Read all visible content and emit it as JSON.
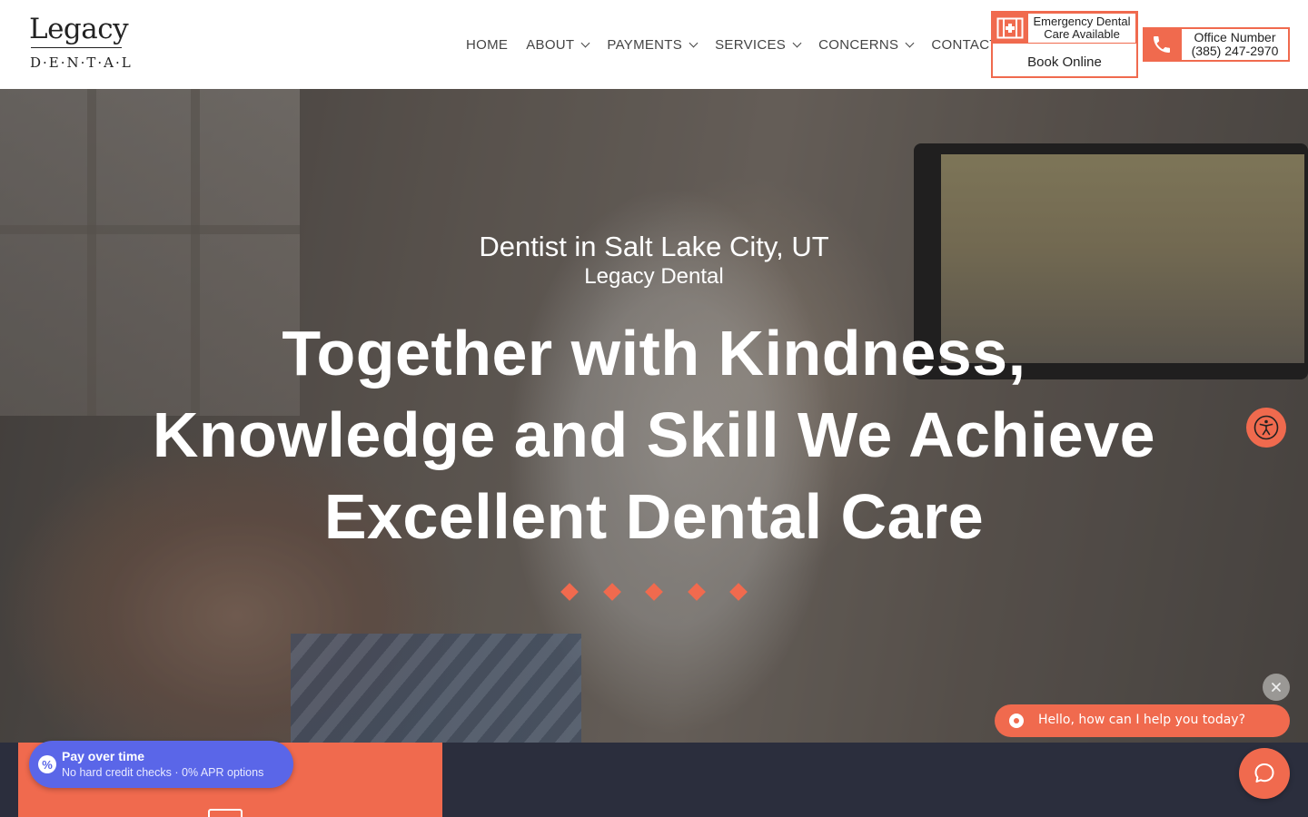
{
  "brand": {
    "logo_top": "Legacy",
    "logo_bottom": "D·E·N·T·A·L"
  },
  "nav": {
    "items": [
      {
        "label": "HOME",
        "dropdown": false
      },
      {
        "label": "ABOUT",
        "dropdown": true
      },
      {
        "label": "PAYMENTS",
        "dropdown": true
      },
      {
        "label": "SERVICES",
        "dropdown": true
      },
      {
        "label": "CONCERNS",
        "dropdown": true
      },
      {
        "label": "CONTACT",
        "dropdown": false
      }
    ]
  },
  "emergency": {
    "line1": "Emergency Dental",
    "line2": "Care Available",
    "icon": "medical-cross-icon"
  },
  "book_online": "Book Online",
  "office": {
    "label": "Office Number",
    "phone": "(385) 247-2970",
    "icon": "phone-icon"
  },
  "hero": {
    "subtitle": "Dentist in Salt Lake City, UT",
    "practice": "Legacy Dental",
    "title_lines": [
      "Together with Kindness,",
      "Knowledge and Skill We Achieve",
      "Excellent Dental Care"
    ],
    "diamond_count": 5
  },
  "pay_widget": {
    "icon": "percent-icon",
    "title": "Pay over time",
    "subtitle": "No hard credit checks · 0% APR options"
  },
  "chat": {
    "greeting": "Hello, how can I help you today?",
    "close_icon": "close-icon",
    "launcher_icon": "chat-icon"
  },
  "accessibility": {
    "icon": "accessibility-icon"
  },
  "colors": {
    "accent": "#f06a4e",
    "dark_band": "#2b2e3d",
    "pay_widget": "#5a66e8"
  }
}
